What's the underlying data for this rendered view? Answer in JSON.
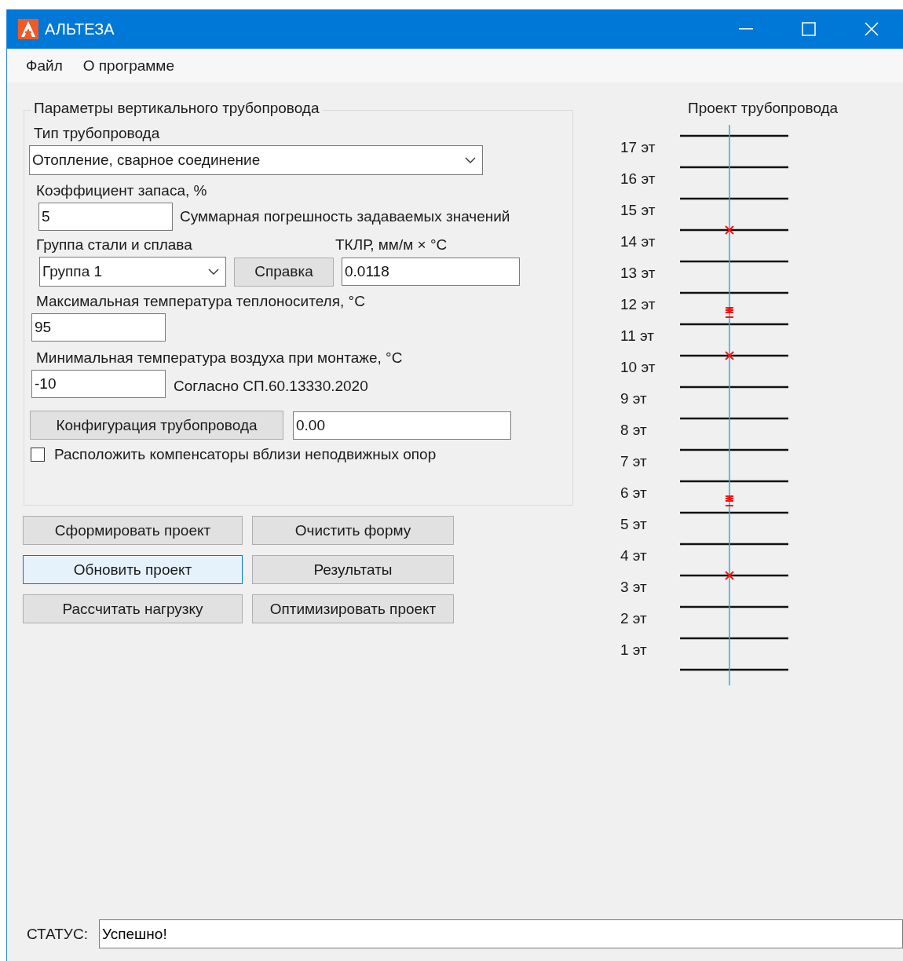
{
  "window": {
    "title": "АЛЬТЕЗА"
  },
  "menu": [
    "Файл",
    "О программе"
  ],
  "params": {
    "legend": "Параметры вертикального трубопровода",
    "pipe_type": {
      "label": "Тип трубопровода",
      "value": "Отопление, сварное соединение"
    },
    "margin": {
      "label": "Коэффициент запаса, %",
      "value": "5",
      "note": "Суммарная погрешность задаваемых значений"
    },
    "steel": {
      "label": "Группа стали и сплава",
      "value": "Группа 1",
      "help_button": "Справка"
    },
    "tklr": {
      "label": "ТКЛР, мм/м × °C",
      "value": "0.0118"
    },
    "max_temp": {
      "label": "Максимальная температура теплоносителя, °C",
      "value": "95"
    },
    "min_temp": {
      "label": "Минимальная температура воздуха при монтаже, °C",
      "value": "-10",
      "note": "Согласно СП.60.13330.2020"
    },
    "config": {
      "button": "Конфигурация трубопровода",
      "value": "0.00"
    },
    "place_compensators": {
      "label": "Расположить компенсаторы вблизи неподвижных опор",
      "checked": false
    }
  },
  "buttons": [
    {
      "label": "Сформировать проект",
      "focused": false
    },
    {
      "label": "Очистить форму",
      "focused": false
    },
    {
      "label": "Обновить проект",
      "focused": true
    },
    {
      "label": "Результаты",
      "focused": false
    },
    {
      "label": "Рассчитать нагрузку",
      "focused": false
    },
    {
      "label": "Оптимизировать проект",
      "focused": false
    }
  ],
  "project": {
    "title": "Проект трубопровода",
    "floors": [
      {
        "label": "17 эт",
        "support": false,
        "compensator": false
      },
      {
        "label": "16 эт",
        "support": false,
        "compensator": false
      },
      {
        "label": "15 эт",
        "support": false,
        "compensator": false
      },
      {
        "label": "14 эт",
        "support": true,
        "compensator": false
      },
      {
        "label": "13 эт",
        "support": false,
        "compensator": false
      },
      {
        "label": "12 эт",
        "support": false,
        "compensator": true
      },
      {
        "label": "11 эт",
        "support": false,
        "compensator": false
      },
      {
        "label": "10 эт",
        "support": true,
        "compensator": false
      },
      {
        "label": "9 эт",
        "support": false,
        "compensator": false
      },
      {
        "label": "8 эт",
        "support": false,
        "compensator": false
      },
      {
        "label": "7 эт",
        "support": false,
        "compensator": false
      },
      {
        "label": "6 эт",
        "support": false,
        "compensator": true
      },
      {
        "label": "5 эт",
        "support": false,
        "compensator": false
      },
      {
        "label": "4 эт",
        "support": false,
        "compensator": false
      },
      {
        "label": "3 эт",
        "support": true,
        "compensator": false
      },
      {
        "label": "2 эт",
        "support": false,
        "compensator": false
      },
      {
        "label": "1 эт",
        "support": false,
        "compensator": false
      }
    ]
  },
  "status": {
    "label": "СТАТУС:",
    "value": "Успешно!"
  }
}
